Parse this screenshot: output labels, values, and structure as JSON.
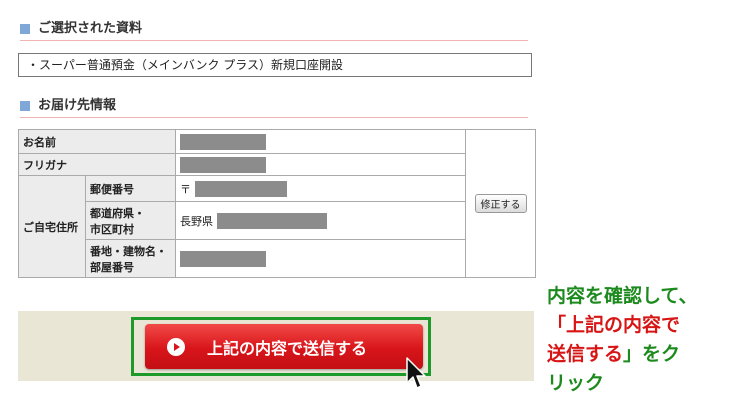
{
  "section_selected": {
    "title": "ご選択された資料"
  },
  "selected_item": "・スーパー普通預金（メインバンク プラス）新規口座開設",
  "section_delivery": {
    "title": "お届け先情報"
  },
  "table": {
    "name_label": "お名前",
    "kana_label": "フリガナ",
    "home_label": "ご自宅住所",
    "postal_label": "郵便番号",
    "postal_prefix": "〒",
    "pref_label_1": "都道府県・",
    "pref_label_2": "市区町村",
    "pref_prefix": "長野県",
    "street_label_1": "番地・建物名・",
    "street_label_2": "部屋番号",
    "edit_button": "修正する"
  },
  "submit_button": "上記の内容で送信する",
  "annotation": {
    "line1": "内容を確認して、",
    "line2a": "「上記の内容で",
    "line3a": "送信する",
    "line3b": "」をク",
    "line4": "リック"
  },
  "colors": {
    "accent_square": "#7fa7d8",
    "submit_red": "#d8151a",
    "highlight_green": "#1d9a2a",
    "annotation_green": "#1d8a1d",
    "annotation_red": "#d81515"
  }
}
